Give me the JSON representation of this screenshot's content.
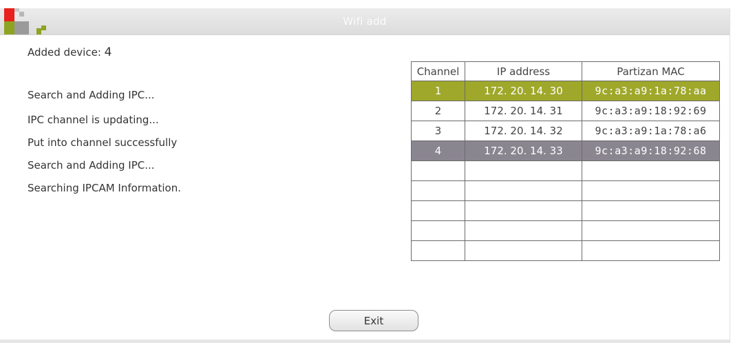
{
  "window": {
    "title": "Wifi add"
  },
  "status": {
    "added_label": "Added device: ",
    "added_count": "4"
  },
  "log": [
    "Search and Adding IPC...",
    "IPC channel is updating...",
    "Put into channel successfully",
    "Search and Adding IPC...",
    "Searching IPCAM Information."
  ],
  "table": {
    "headers": [
      "Channel",
      "IP address",
      "Partizan MAC"
    ],
    "rows": [
      {
        "channel": "1",
        "ip": "172. 20. 14. 30",
        "mac": "9c:a3:a9:1a:78:aa",
        "highlight": "#9fa82a"
      },
      {
        "channel": "2",
        "ip": "172. 20. 14. 31",
        "mac": "9c:a3:a9:18:92:69"
      },
      {
        "channel": "3",
        "ip": "172. 20. 14. 32",
        "mac": "9c:a3:a9:1a:78:a6"
      },
      {
        "channel": "4",
        "ip": "172. 20. 14. 33",
        "mac": "9c:a3:a9:18:92:68",
        "highlight": "#8a8690"
      }
    ]
  },
  "buttons": {
    "exit_label": "Exit"
  },
  "colors": {
    "logo_red": "#e8201e",
    "logo_green": "#8fa322",
    "logo_gray": "#9a9a9a"
  }
}
